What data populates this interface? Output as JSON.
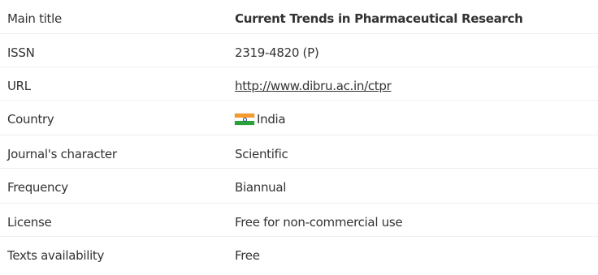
{
  "rows": [
    {
      "label": "Main title",
      "value": "Current Trends in Pharmaceutical Research"
    },
    {
      "label": "ISSN",
      "value": "2319-4820 (P)"
    },
    {
      "label": "URL",
      "value": "http://www.dibru.ac.in/ctpr"
    },
    {
      "label": "Country",
      "value": "India"
    },
    {
      "label": "Journal's character",
      "value": "Scientific"
    },
    {
      "label": "Frequency",
      "value": "Biannual"
    },
    {
      "label": "License",
      "value": "Free for non-commercial use"
    },
    {
      "label": "Texts availability",
      "value": "Free"
    }
  ],
  "icons": {
    "country_flag": "india-flag-icon"
  },
  "colors": {
    "text": "#333333",
    "flag_saffron": "#f59a2b",
    "flag_green": "#27a33a",
    "flag_chakra": "#1f3c8f"
  }
}
